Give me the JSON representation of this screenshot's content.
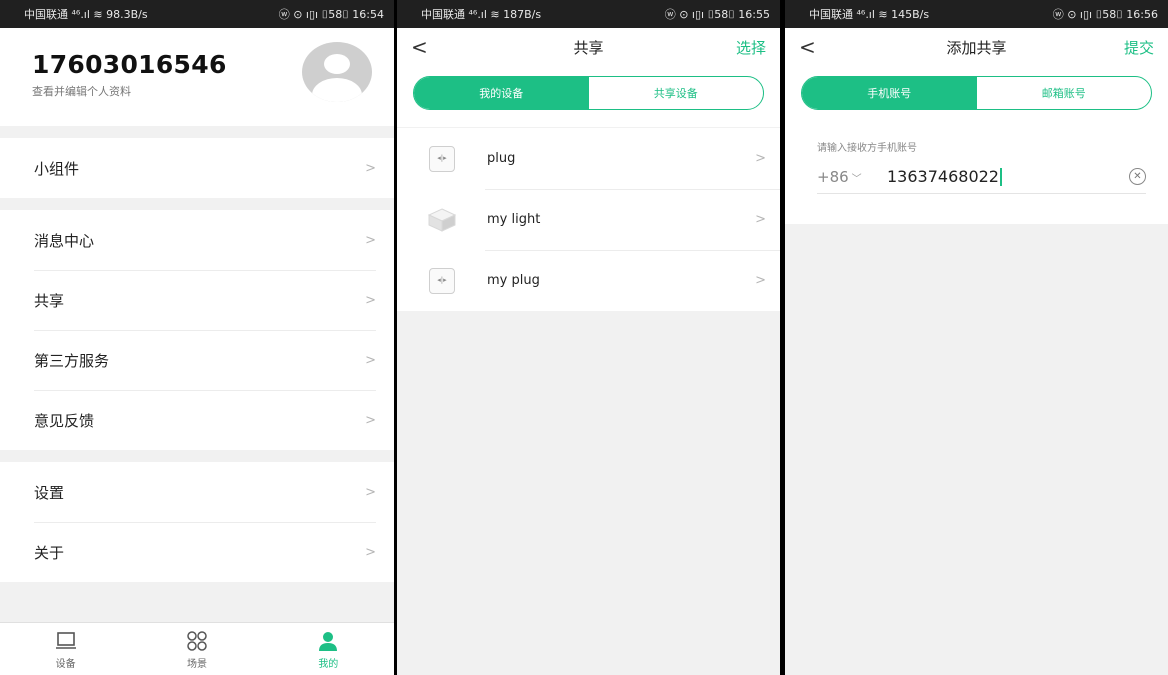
{
  "screens": {
    "profile": {
      "status": {
        "left": "中国联通 ⁴⁶.ıl ≋ 98.3B/s",
        "right": "ⓦ ⊙ ı▯ı ⌷58⌷ 16:54"
      },
      "phone": "17603016546",
      "subtitle": "查看并编辑个人资料",
      "groups": [
        [
          "小组件"
        ],
        [
          "消息中心",
          "共享",
          "第三方服务",
          "意见反馈"
        ],
        [
          "设置",
          "关于"
        ]
      ],
      "tabs": [
        {
          "label": "设备",
          "icon": "laptop-icon"
        },
        {
          "label": "场景",
          "icon": "scenes-grid-icon"
        },
        {
          "label": "我的",
          "icon": "user-icon"
        }
      ]
    },
    "share": {
      "status": {
        "left": "中国联通 ⁴⁶.ıl ≋ 187B/s",
        "right": "ⓦ ⊙ ı▯ı ⌷58⌷ 16:55"
      },
      "title": "共享",
      "action": "选择",
      "segments": [
        "我的设备",
        "共享设备"
      ],
      "devices": [
        {
          "name": "plug",
          "icon": "plug-icon"
        },
        {
          "name": "my light",
          "icon": "light-box-icon"
        },
        {
          "name": "my plug",
          "icon": "plug-icon"
        }
      ]
    },
    "add_share": {
      "status": {
        "left": "中国联通 ⁴⁶.ıl ≋ 145B/s",
        "right": "ⓦ ⊙ ı▯ı ⌷58⌷ 16:56"
      },
      "title": "添加共享",
      "action": "提交",
      "segments": [
        "手机账号",
        "邮箱账号"
      ],
      "field_label": "请输入接收方手机账号",
      "country_code": "+86",
      "phone_value": "13637468022"
    }
  },
  "colors": {
    "accent": "#1dbf85",
    "background": "#f1f1f1"
  }
}
